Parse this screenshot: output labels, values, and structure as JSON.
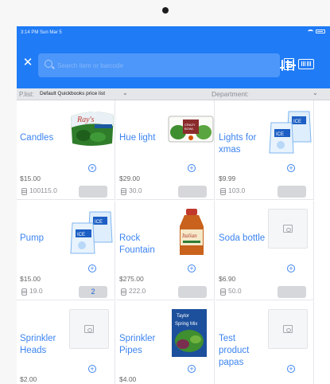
{
  "status_bar": {
    "time": "3:14 PM  Sun Mar 5"
  },
  "toolbar": {
    "close_icon": "close-icon",
    "search_placeholder": "Search item or barcode",
    "filter_icon": "sliders-icon",
    "list_icon": "list-icon",
    "scan_icon": "barcode-icon",
    "accent": "#1f7bf6"
  },
  "filter_bar": {
    "price_list_label": "P.list:",
    "price_list_value": "Default Quickbooks price list",
    "department_label": "Department:"
  },
  "items": [
    {
      "name": "Candles",
      "price": "$15.00",
      "stock": "100115.0",
      "qty": "",
      "image": "spinach-bag"
    },
    {
      "name": "Hue light",
      "price": "$29.00",
      "stock": "30.0",
      "qty": "",
      "image": "salad-box"
    },
    {
      "name": "Lights for xmas",
      "price": "$9.99",
      "stock": "103.0",
      "qty": "",
      "image": "ice-bags"
    },
    {
      "name": "Pump",
      "price": "$15.00",
      "stock": "19.0",
      "qty": "2",
      "image": "ice-bags"
    },
    {
      "name": "Rock Fountain",
      "price": "$275.00",
      "stock": "222.0",
      "qty": "",
      "image": "dressing-bottle"
    },
    {
      "name": "Soda bottle",
      "price": "$6.90",
      "stock": "50.0",
      "qty": "",
      "image": "placeholder"
    },
    {
      "name": "Sprinkler Heads",
      "price": "$2.00",
      "stock": "",
      "qty": "",
      "image": "placeholder"
    },
    {
      "name": "Sprinkler Pipes",
      "price": "$4.00",
      "stock": "",
      "qty": "",
      "image": "spring-mix"
    },
    {
      "name": "Test product papas",
      "price": "",
      "stock": "",
      "qty": "",
      "image": "placeholder"
    }
  ]
}
